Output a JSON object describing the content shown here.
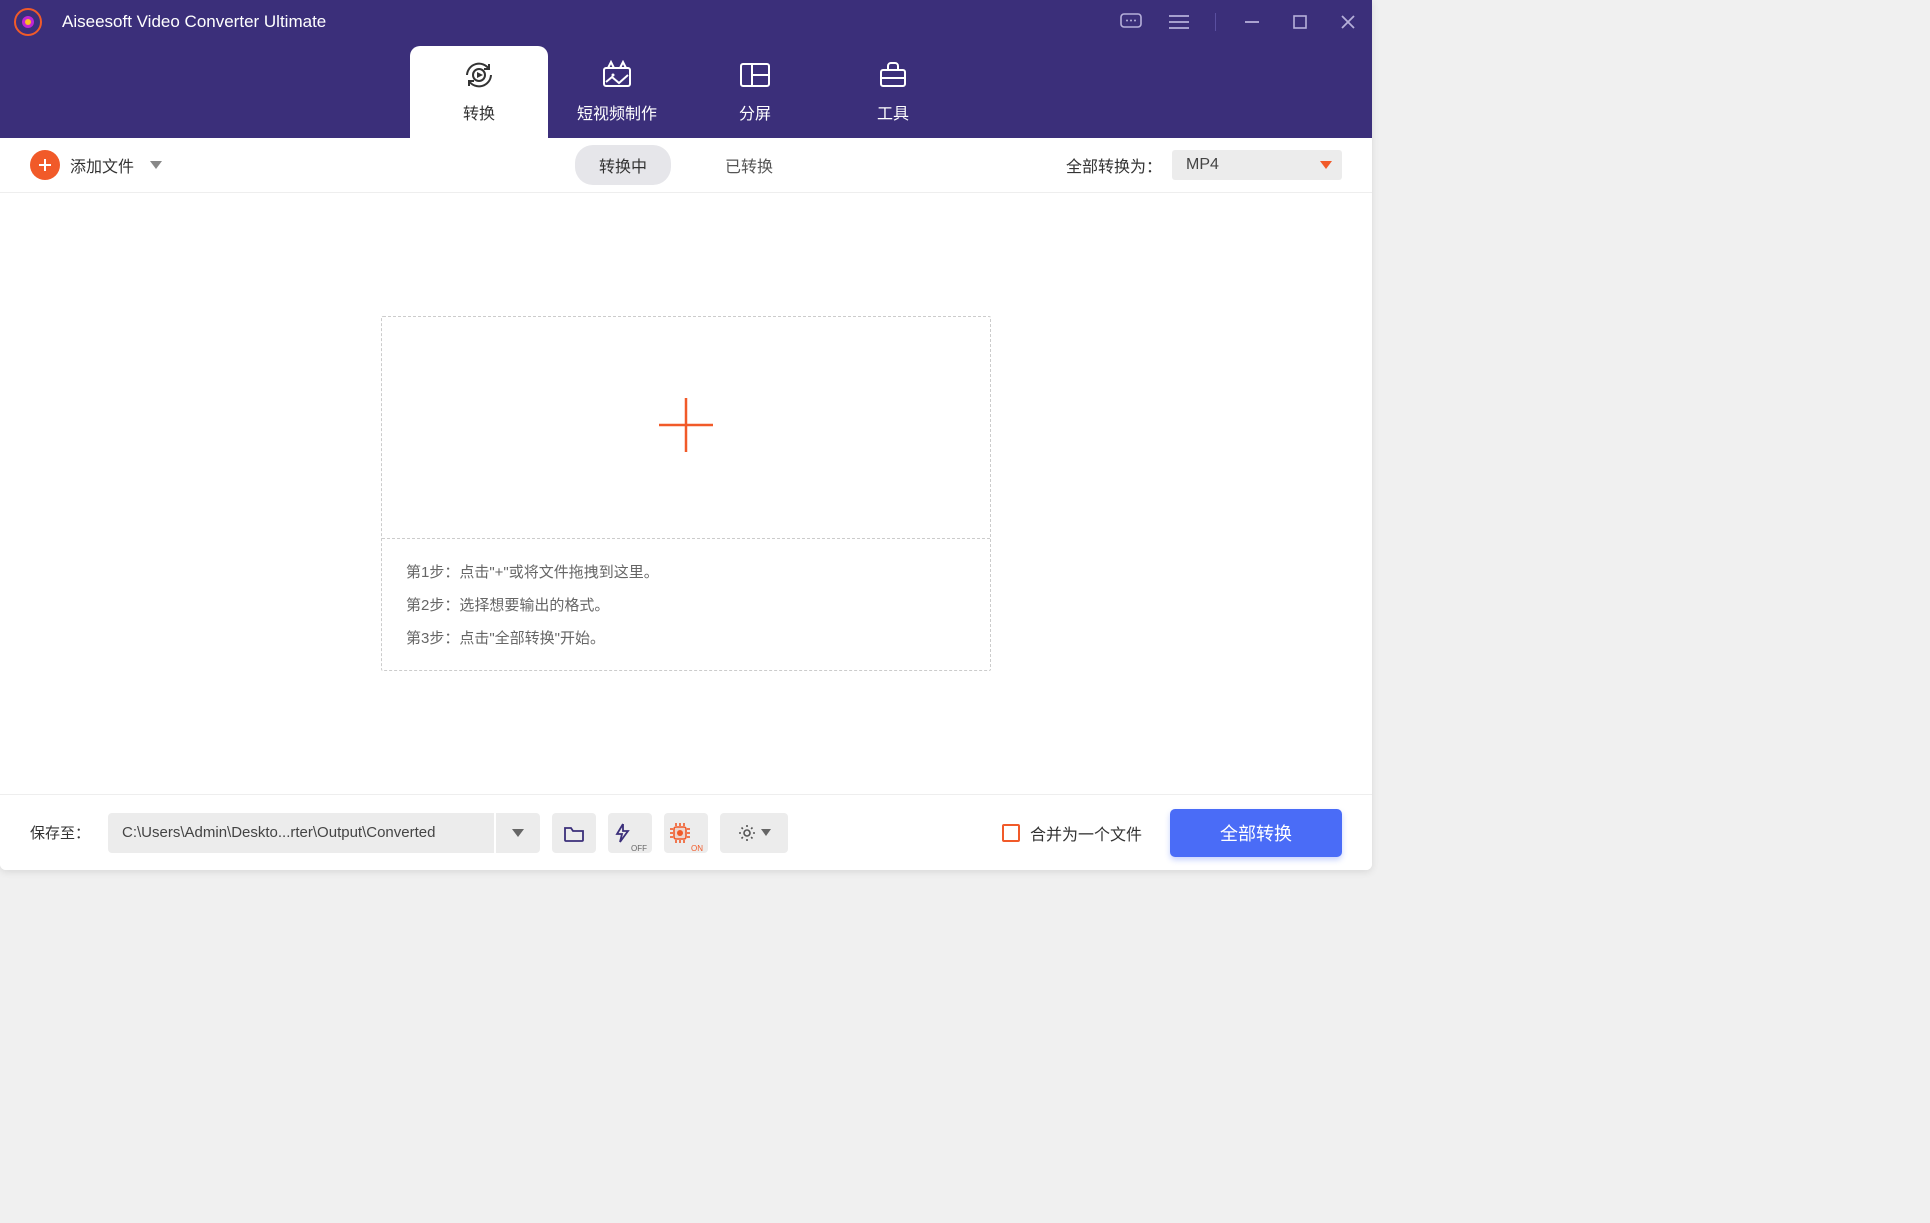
{
  "app": {
    "title": "Aiseesoft Video Converter Ultimate"
  },
  "tabs": {
    "convert": "转换",
    "shortVideo": "短视频制作",
    "splitScreen": "分屏",
    "tools": "工具"
  },
  "toolbar": {
    "addFile": "添加文件",
    "statusConverting": "转换中",
    "statusConverted": "已转换",
    "convertAllToLabel": "全部转换为：",
    "format": "MP4"
  },
  "dropArea": {
    "step1": "第1步：点击\"+\"或将文件拖拽到这里。",
    "step2": "第2步：选择想要输出的格式。",
    "step3": "第3步：点击\"全部转换\"开始。"
  },
  "bottom": {
    "saveToLabel": "保存至：",
    "path": "C:\\Users\\Admin\\Deskto...rter\\Output\\Converted",
    "mergeLabel": "合并为一个文件",
    "convertAllBtn": "全部转换",
    "speedup_off": "OFF",
    "gpu_on": "ON"
  },
  "colors": {
    "primary": "#3b2f7a",
    "accent": "#f15a29",
    "button": "#4a6cf7"
  }
}
